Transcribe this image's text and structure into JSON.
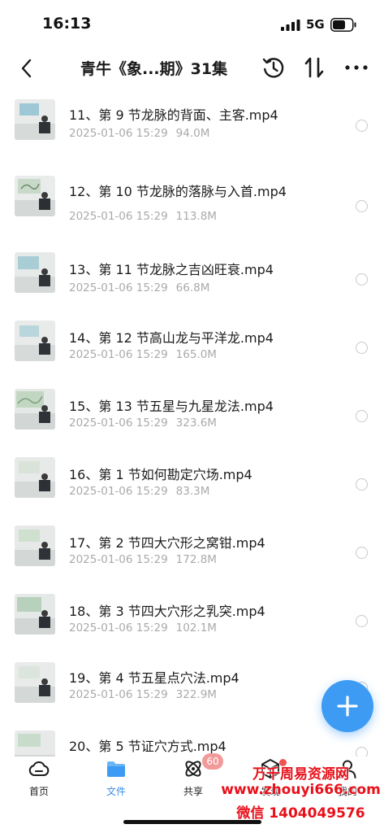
{
  "status_bar": {
    "time": "16:13",
    "network": "5G",
    "icons": [
      "signal-icon",
      "battery-icon"
    ]
  },
  "nav": {
    "title": "青牛《象...期》31集",
    "icons": [
      "back-icon",
      "history-icon",
      "sort-icon",
      "more-icon"
    ]
  },
  "files": [
    {
      "name": "11、第 9 节龙脉的背面、主客.mp4",
      "date": "2025-01-06 15:29",
      "size": "94.0M"
    },
    {
      "name": "12、第 10 节龙脉的落脉与入首.mp4",
      "date": "2025-01-06 15:29",
      "size": "113.8M"
    },
    {
      "name": "13、第 11 节龙脉之吉凶旺衰.mp4",
      "date": "2025-01-06 15:29",
      "size": "66.8M"
    },
    {
      "name": "14、第 12 节高山龙与平洋龙.mp4",
      "date": "2025-01-06 15:29",
      "size": "165.0M"
    },
    {
      "name": "15、第 13 节五星与九星龙法.mp4",
      "date": "2025-01-06 15:29",
      "size": "323.6M"
    },
    {
      "name": "16、第 1 节如何勘定穴场.mp4",
      "date": "2025-01-06 15:29",
      "size": "83.3M"
    },
    {
      "name": "17、第 2 节四大穴形之窝钳.mp4",
      "date": "2025-01-06 15:29",
      "size": "172.8M"
    },
    {
      "name": "18、第 3 节四大穴形之乳突.mp4",
      "date": "2025-01-06 15:29",
      "size": "102.1M"
    },
    {
      "name": "19、第 4 节五星点穴法.mp4",
      "date": "2025-01-06 15:29",
      "size": "322.9M"
    },
    {
      "name": "20、第 5 节证穴方式.mp4",
      "date": "",
      "size": ""
    }
  ],
  "fab": {
    "icon": "plus-icon"
  },
  "tabs": [
    {
      "label": "首页",
      "icon": "cloud-icon",
      "active": false
    },
    {
      "label": "文件",
      "icon": "folder-icon",
      "active": true
    },
    {
      "label": "共享",
      "icon": "share-atom-icon",
      "active": false,
      "badge": "60"
    },
    {
      "label": "发现",
      "icon": "cube-icon",
      "active": false
    },
    {
      "label": "我的",
      "icon": "user-icon",
      "active": false
    }
  ],
  "watermark": {
    "line1": "万千周易资源网",
    "line2": "www.zhouyi666.com",
    "line3": "微信 1404049576"
  },
  "colors": {
    "accent": "#3d9bf3",
    "active_tab": "#3a8ee6",
    "meta_text": "#aaaaaa",
    "badge": "#f19a9a",
    "watermark": "#e8101a"
  }
}
